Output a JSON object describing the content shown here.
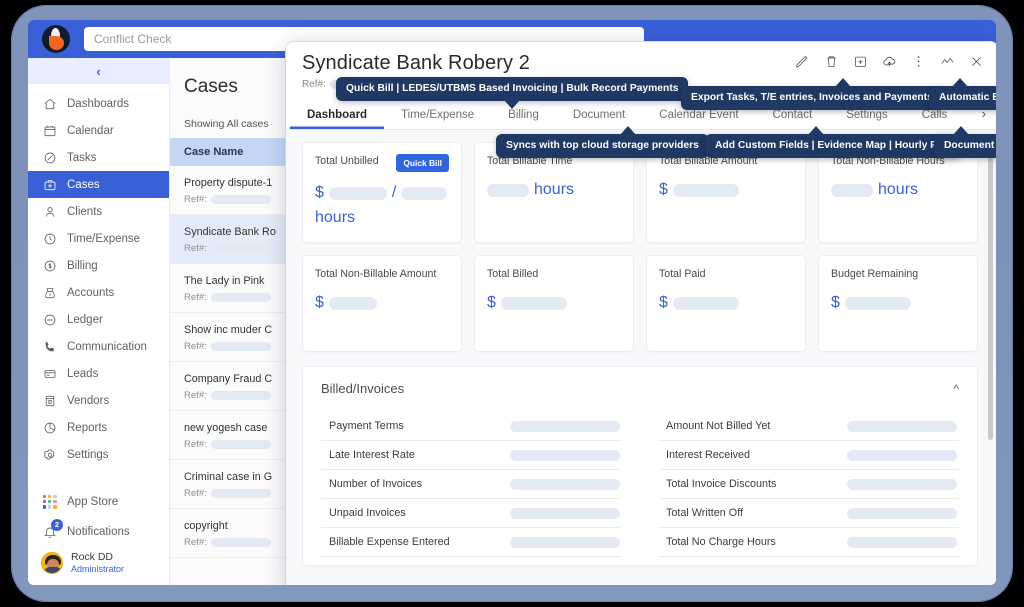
{
  "topbar": {
    "logo_name": "app-logo",
    "search_placeholder": "Conflict Check",
    "search_value": ""
  },
  "sidebar": {
    "collapse_icon": "chevron-left-icon",
    "items": [
      {
        "label": "Dashboards",
        "icon": "home-icon",
        "active": false
      },
      {
        "label": "Calendar",
        "icon": "calendar-icon",
        "active": false
      },
      {
        "label": "Tasks",
        "icon": "check-circle-icon",
        "active": false
      },
      {
        "label": "Cases",
        "icon": "briefcase-icon",
        "active": true
      },
      {
        "label": "Clients",
        "icon": "user-icon",
        "active": false
      },
      {
        "label": "Time/Expense",
        "icon": "clock-icon",
        "active": false
      },
      {
        "label": "Billing",
        "icon": "dollar-circle-icon",
        "active": false
      },
      {
        "label": "Accounts",
        "icon": "bank-icon",
        "active": false
      },
      {
        "label": "Ledger",
        "icon": "coin-icon",
        "active": false
      },
      {
        "label": "Communication",
        "icon": "phone-icon",
        "active": false
      },
      {
        "label": "Leads",
        "icon": "card-icon",
        "active": false
      },
      {
        "label": "Vendors",
        "icon": "building-icon",
        "active": false
      },
      {
        "label": "Reports",
        "icon": "pie-chart-icon",
        "active": false
      },
      {
        "label": "Settings",
        "icon": "gear-icon",
        "active": false
      }
    ],
    "app_store": {
      "label": "App Store",
      "icon": "grid-apps-icon"
    },
    "notifications": {
      "label": "Notifications",
      "icon": "bell-icon",
      "count": "2"
    },
    "user": {
      "name": "Rock DD",
      "role": "Administrator",
      "avatar": "user-avatar"
    }
  },
  "caselist": {
    "title": "Cases",
    "showing": "Showing All cases",
    "column_header": "Case Name",
    "ref_label": "Ref#:",
    "rows": [
      {
        "name": "Property dispute-1",
        "selected": false
      },
      {
        "name": "Syndicate Bank Ro",
        "selected": true
      },
      {
        "name": "The Lady in Pink",
        "selected": false
      },
      {
        "name": "Show inc muder C",
        "selected": false
      },
      {
        "name": "Company Fraud C",
        "selected": false
      },
      {
        "name": "new yogesh case",
        "selected": false
      },
      {
        "name": "Criminal case in G",
        "selected": false
      },
      {
        "name": "copyright",
        "selected": false
      }
    ]
  },
  "modal": {
    "title": "Syndicate Bank Robery 2",
    "ref_label": "Ref#:",
    "header_icons": [
      {
        "name": "edit-pencil-icon",
        "glyph": "pencil"
      },
      {
        "name": "delete-trash-icon",
        "glyph": "trash"
      },
      {
        "name": "archive-box-icon",
        "glyph": "archive"
      },
      {
        "name": "cloud-upload-icon",
        "glyph": "cloud"
      },
      {
        "name": "more-options-icon",
        "glyph": "dots"
      },
      {
        "name": "activity-chart-icon",
        "glyph": "activity"
      },
      {
        "name": "close-icon",
        "glyph": "close"
      }
    ],
    "tabs": [
      {
        "label": "Dashboard",
        "active": true
      },
      {
        "label": "Time/Expense",
        "active": false
      },
      {
        "label": "Billing",
        "active": false
      },
      {
        "label": "Document",
        "active": false
      },
      {
        "label": "Calendar Event",
        "active": false
      },
      {
        "label": "Contact",
        "active": false
      },
      {
        "label": "Settings",
        "active": false
      },
      {
        "label": "Calls",
        "active": false
      }
    ],
    "tabs_next_icon": "chevron-right-icon",
    "stats": [
      {
        "label": "Total Unbilled",
        "prefix": "$",
        "suffix": "",
        "badge": "Quick Bill",
        "style": "dual-hours"
      },
      {
        "label": "Total Billable Time",
        "prefix": "",
        "suffix": "hours",
        "badge": null,
        "style": "hours"
      },
      {
        "label": "Total Billable Amount",
        "prefix": "$",
        "suffix": "",
        "badge": null,
        "style": "money"
      },
      {
        "label": "Total Non-Billable Hours",
        "prefix": "",
        "suffix": "hours",
        "badge": null,
        "style": "hours"
      },
      {
        "label": "Total Non-Billable Amount",
        "prefix": "$",
        "suffix": "",
        "badge": null,
        "style": "money"
      },
      {
        "label": "Total Billed",
        "prefix": "$",
        "suffix": "",
        "badge": null,
        "style": "money"
      },
      {
        "label": "Total Paid",
        "prefix": "$",
        "suffix": "",
        "badge": null,
        "style": "money"
      },
      {
        "label": "Budget Remaining",
        "prefix": "$",
        "suffix": "",
        "badge": null,
        "style": "money"
      }
    ],
    "panel": {
      "title": "Billed/Invoices",
      "collapse_icon": "chevron-up-icon",
      "left_fields": [
        "Payment Terms",
        "Late Interest Rate",
        "Number of Invoices",
        "Unpaid Invoices",
        "Billable Expense Entered"
      ],
      "right_fields": [
        "Amount Not Billed Yet",
        "Interest Received",
        "Total Invoice Discounts",
        "Total Written Off",
        "Total No Charge Hours"
      ]
    }
  },
  "tooltips": [
    {
      "id": "tip-quick-bill",
      "text": "Quick Bill | LEDES/UTBMS Based Invoicing | Bulk Record Payments",
      "arrow": "down"
    },
    {
      "id": "tip-export",
      "text": "Export Tasks, T/E entries, Invoices and Payments",
      "arrow": "up"
    },
    {
      "id": "tip-auto-billing",
      "text": "Automatic Billing",
      "arrow": "up"
    },
    {
      "id": "tip-cloud-sync",
      "text": "Syncs with top cloud storage providers",
      "arrow": "up"
    },
    {
      "id": "tip-custom-fields",
      "text": "Add Custom Fields | Evidence Map | Hourly Rate",
      "arrow": "up"
    },
    {
      "id": "tip-doc-assembly",
      "text": "Document Assembly",
      "arrow": "up"
    }
  ],
  "colors": {
    "brand_blue": "#3a60d8",
    "tooltip_navy": "#1f3864",
    "frame_slate": "#7f93bb",
    "redact_gray": "#e5e9f3",
    "selected_row": "#e4ecfb"
  }
}
